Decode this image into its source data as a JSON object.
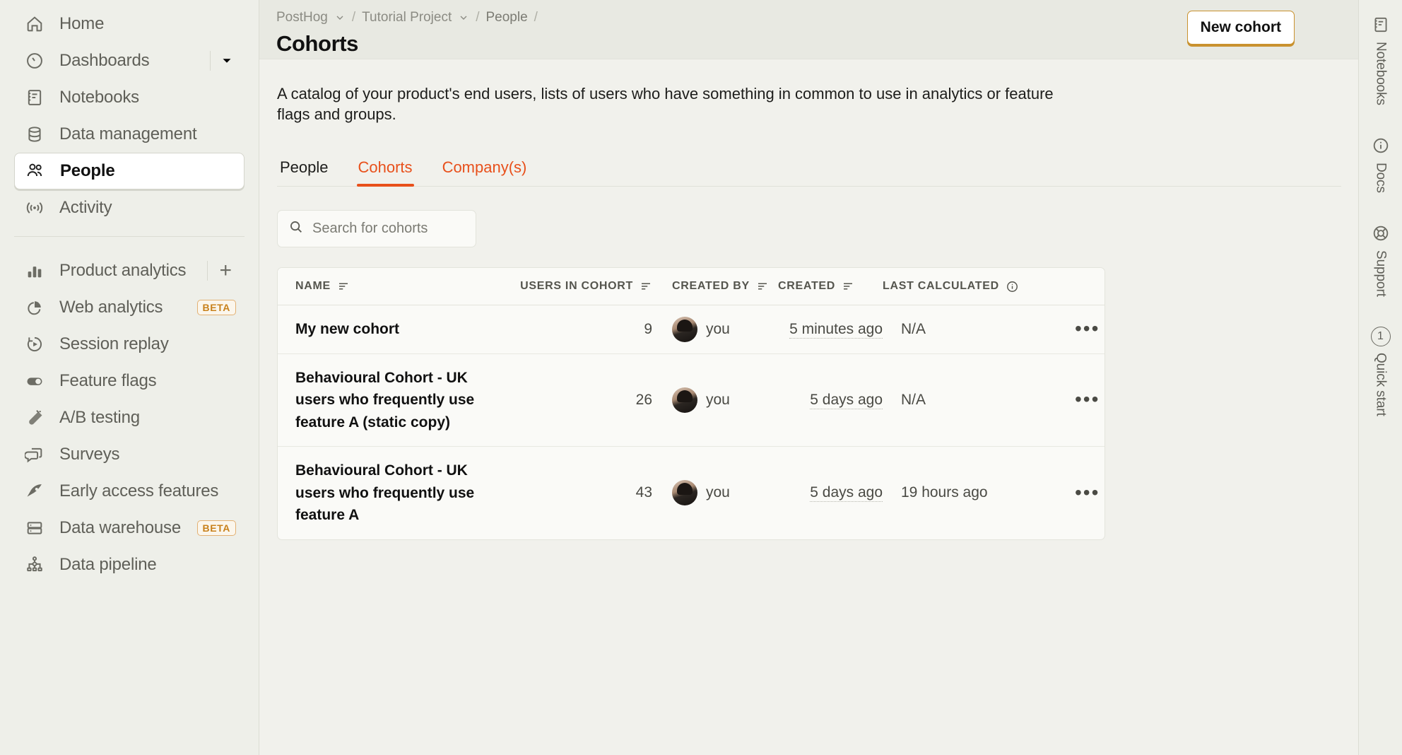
{
  "sidebar": {
    "primary": [
      {
        "label": "Home",
        "icon": "home-icon"
      },
      {
        "label": "Dashboards",
        "icon": "gauge-icon",
        "chevron": true
      },
      {
        "label": "Notebooks",
        "icon": "notebook-icon"
      },
      {
        "label": "Data management",
        "icon": "database-icon"
      },
      {
        "label": "People",
        "icon": "people-icon",
        "active": true
      },
      {
        "label": "Activity",
        "icon": "activity-icon"
      }
    ],
    "secondary": [
      {
        "label": "Product analytics",
        "icon": "bar-chart-icon",
        "plus": true
      },
      {
        "label": "Web analytics",
        "icon": "pie-chart-icon",
        "badge": "BETA"
      },
      {
        "label": "Session replay",
        "icon": "play-replay-icon"
      },
      {
        "label": "Feature flags",
        "icon": "toggle-icon"
      },
      {
        "label": "A/B testing",
        "icon": "flask-icon"
      },
      {
        "label": "Surveys",
        "icon": "chat-bubbles-icon"
      },
      {
        "label": "Early access features",
        "icon": "rocket-icon"
      },
      {
        "label": "Data warehouse",
        "icon": "server-icon",
        "badge": "BETA"
      },
      {
        "label": "Data pipeline",
        "icon": "pipeline-icon"
      }
    ]
  },
  "topbar": {
    "breadcrumbs": [
      {
        "label": "PostHog",
        "chevron": true
      },
      {
        "label": "Tutorial Project",
        "chevron": true
      },
      {
        "label": "People",
        "chevron": false
      }
    ],
    "separator": "/",
    "page_title": "Cohorts",
    "new_cohort_label": "New cohort"
  },
  "content": {
    "description": "A catalog of your product's end users, lists of users who have something in common to use in analytics or feature flags and groups.",
    "tabs": [
      {
        "label": "People",
        "state": "inactive"
      },
      {
        "label": "Cohorts",
        "state": "active"
      },
      {
        "label": "Company(s)",
        "state": "link"
      }
    ],
    "search": {
      "placeholder": "Search for cohorts",
      "value": "",
      "icon": "search-icon"
    }
  },
  "table": {
    "columns": [
      {
        "key": "name",
        "label": "NAME",
        "sortable": true
      },
      {
        "key": "users",
        "label": "USERS IN COHORT",
        "sortable": true
      },
      {
        "key": "created_by",
        "label": "CREATED BY",
        "sortable": true
      },
      {
        "key": "created",
        "label": "CREATED",
        "sortable": true
      },
      {
        "key": "last_calculated",
        "label": "LAST CALCULATED",
        "info": true
      }
    ],
    "rows": [
      {
        "name": "My new cohort",
        "users": "9",
        "created_by": "you",
        "created": "5 minutes ago",
        "last_calculated": "N/A",
        "menu": "•••"
      },
      {
        "name": "Behavioural Cohort - UK users who frequently use feature A (static copy)",
        "users": "26",
        "created_by": "you",
        "created": "5 days ago",
        "last_calculated": "N/A",
        "menu": "•••"
      },
      {
        "name": "Behavioural Cohort - UK users who frequently use feature A",
        "users": "43",
        "created_by": "you",
        "created": "5 days ago",
        "last_calculated": "19 hours ago",
        "menu": "•••"
      }
    ]
  },
  "rail": {
    "items": [
      {
        "label": "Notebooks",
        "icon": "notebook-icon"
      },
      {
        "label": "Docs",
        "icon": "info-circle-icon"
      },
      {
        "label": "Support",
        "icon": "lifebuoy-icon"
      },
      {
        "label": "Quick start",
        "icon": "badge-count-icon",
        "count": "1"
      }
    ]
  },
  "colors": {
    "accent": "#E8501B",
    "brand_border": "#C9922F",
    "beta_badge": "#C8811C",
    "sidebar_bg": "#EEEFE9",
    "content_bg": "#F1F1EC"
  }
}
